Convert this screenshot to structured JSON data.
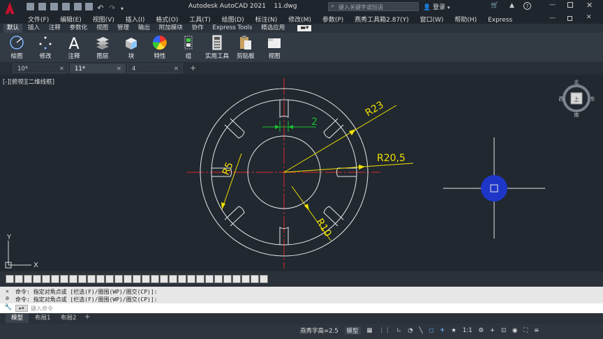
{
  "app": {
    "title": "Autodesk AutoCAD 2021",
    "filename": "11.dwg",
    "search_placeholder": "键入关键字或短语",
    "login_label": "登录",
    "logo_letter": "A"
  },
  "menu": [
    "文件(F)",
    "编辑(E)",
    "视图(V)",
    "插入(I)",
    "格式(O)",
    "工具(T)",
    "绘图(D)",
    "标注(N)",
    "修改(M)",
    "参数(P)",
    "燕秀工具箱2.87(Y)",
    "窗口(W)",
    "帮助(H)",
    "Express"
  ],
  "ribbon_tabs": [
    "默认",
    "插入",
    "注释",
    "参数化",
    "视图",
    "管理",
    "输出",
    "附加模块",
    "协作",
    "Express Tools",
    "精选应用"
  ],
  "ribbon_buttons": [
    "绘图",
    "修改",
    "注释",
    "图层",
    "块",
    "特性",
    "组",
    "实用工具",
    "剪贴板",
    "视图"
  ],
  "file_tabs": [
    {
      "label": "10*",
      "active": false
    },
    {
      "label": "11*",
      "active": true
    },
    {
      "label": "4",
      "active": false
    }
  ],
  "viewport_label": "[-][俯视][二维线框]",
  "viewcube": {
    "north": "北",
    "south": "南",
    "east": "东",
    "west": "西",
    "top": "上"
  },
  "ucs": {
    "x": "X",
    "y": "Y"
  },
  "dimensions": {
    "gap": "2",
    "r23": "R23",
    "r20_5": "R20,5",
    "r5": "R5",
    "r10": "R10"
  },
  "command_history": [
    "命令: 指定对角点或 [栏选(F)/圈围(WP)/圈交(CP)]:",
    "命令: 指定对角点或 [栏选(F)/圈围(WP)/圈交(CP)]:"
  ],
  "command_placeholder": "键入命令",
  "layout_tabs": [
    {
      "label": "模型",
      "active": true
    },
    {
      "label": "布局1",
      "active": false
    },
    {
      "label": "布局2",
      "active": false
    }
  ],
  "status": {
    "text_height": "燕秀字高=2.5",
    "model_label": "模型",
    "scale": "1:1"
  },
  "colors": {
    "dimension": "#f0e000",
    "centerline": "#e0282c",
    "geometry": "#e8e8e8",
    "grip": "#1e36c8",
    "gap_dim": "#16c030"
  }
}
